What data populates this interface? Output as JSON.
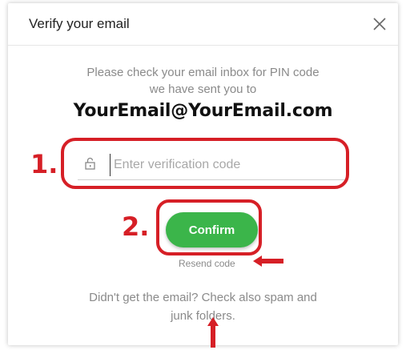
{
  "dialog": {
    "title": "Verify your email",
    "close_icon": "close-icon",
    "info_line1": "Please check your email inbox for PIN code",
    "info_line2": "we have sent you to",
    "email": "YourEmail@YourEmail.com",
    "code_input": {
      "placeholder": "Enter verification code",
      "value": "",
      "icon": "lock-icon"
    },
    "confirm_label": "Confirm",
    "resend_label": "Resend code",
    "hint_line1": "Didn't get the email? Check also spam and",
    "hint_line2": "junk folders."
  },
  "annotations": {
    "step1": "1.",
    "step2": "2."
  },
  "colors": {
    "accent_green": "#3bb54a",
    "annotation_red": "#d61f26",
    "muted_text": "#8a8a8a"
  }
}
